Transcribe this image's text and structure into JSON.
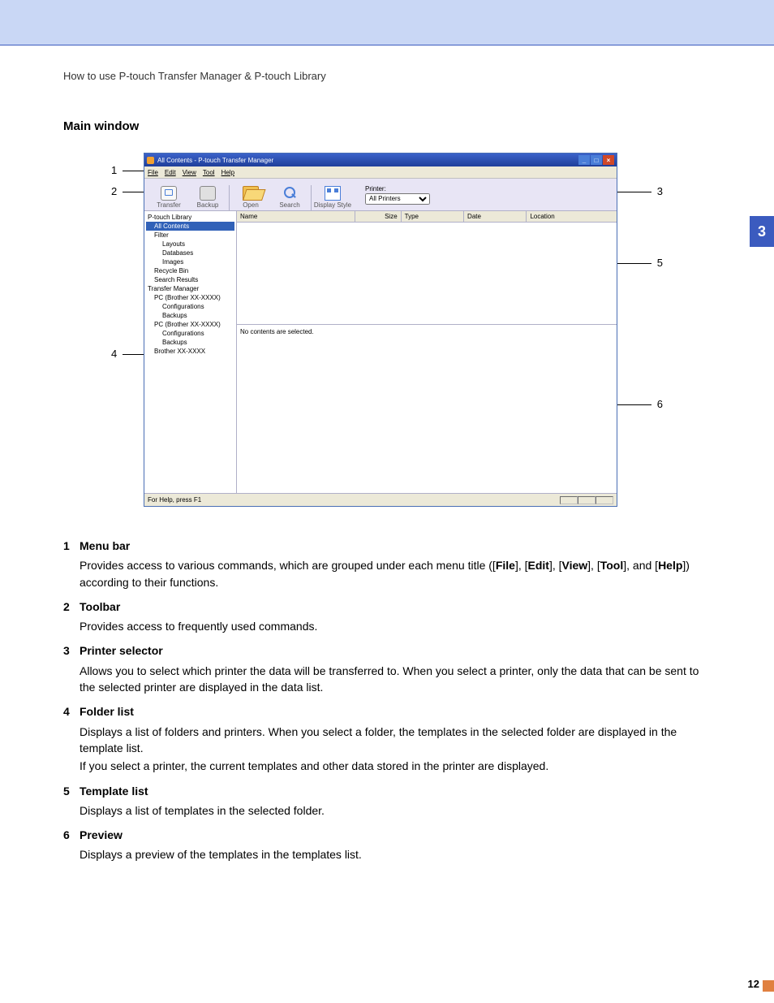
{
  "header": {
    "breadcrumb": "How to use P-touch Transfer Manager & P-touch Library",
    "side_tab": "3"
  },
  "section_title": "Main window",
  "app": {
    "title": "All Contents - P-touch Transfer Manager",
    "menu": {
      "file": "File",
      "edit": "Edit",
      "view": "View",
      "tool": "Tool",
      "help": "Help"
    },
    "toolbar": {
      "transfer": "Transfer",
      "backup": "Backup",
      "open": "Open",
      "search": "Search",
      "display_style": "Display Style"
    },
    "printer": {
      "label": "Printer:",
      "value": "All Printers"
    },
    "columns": {
      "name": "Name",
      "size": "Size",
      "type": "Type",
      "date": "Date",
      "location": "Location"
    },
    "tree": {
      "lib": "P-touch Library",
      "all": "All Contents",
      "filter": "Filter",
      "layouts": "Layouts",
      "databases": "Databases",
      "images": "Images",
      "recycle": "Recycle Bin",
      "search_results": "Search Results",
      "transfer_manager": "Transfer Manager",
      "pc1": "PC (Brother XX-XXXX)",
      "config": "Configurations",
      "backups": "Backups",
      "pc2": "PC (Brother XX-XXXX)",
      "brother": "Brother XX-XXXX"
    },
    "preview_msg": "No contents are selected.",
    "status": "For Help, press F1"
  },
  "callouts": {
    "c1": "1",
    "c2": "2",
    "c3": "3",
    "c4": "4",
    "c5": "5",
    "c6": "6"
  },
  "desc": {
    "i1": {
      "num": "1",
      "title": "Menu bar",
      "body_a": "Provides access to various commands, which are grouped under each menu title ([",
      "file": "File",
      "sep1": "], [",
      "edit": "Edit",
      "sep2": "], [",
      "view": "View",
      "sep3": "], [",
      "tool": "Tool",
      "sep4": "], and [",
      "help": "Help",
      "body_b": "]) according to their functions."
    },
    "i2": {
      "num": "2",
      "title": "Toolbar",
      "body": "Provides access to frequently used commands."
    },
    "i3": {
      "num": "3",
      "title": "Printer selector",
      "body": "Allows you to select which printer the data will be transferred to. When you select a printer, only the data that can be sent to the selected printer are displayed in the data list."
    },
    "i4": {
      "num": "4",
      "title": "Folder list",
      "body_a": "Displays a list of folders and printers. When you select a folder, the templates in the selected folder are displayed in the template list.",
      "body_b": "If you select a printer, the current templates and other data stored in the printer are displayed."
    },
    "i5": {
      "num": "5",
      "title": "Template list",
      "body": "Displays a list of templates in the selected folder."
    },
    "i6": {
      "num": "6",
      "title": "Preview",
      "body": "Displays a preview of the templates in the templates list."
    }
  },
  "page_number": "12"
}
